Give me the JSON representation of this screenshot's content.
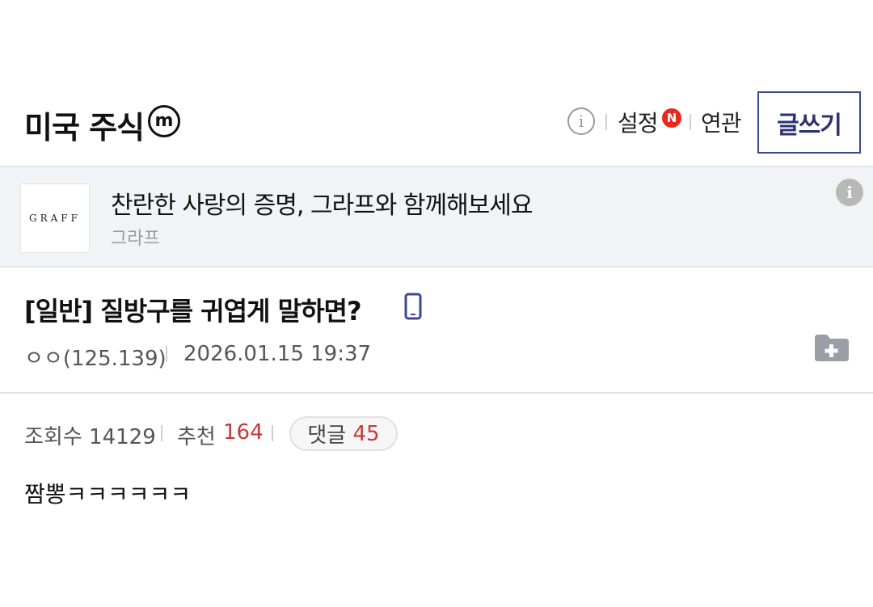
{
  "header": {
    "gallery_title": "미국 주식",
    "minor_badge": "m",
    "info_icon": "i",
    "settings_label": "설정",
    "new_badge": "N",
    "related_label": "연관",
    "write_label": "글쓰기"
  },
  "ad": {
    "logo_text": "GRAFF",
    "headline": "찬란한 사랑의 증명, 그라프와 함께해보세요",
    "advertiser": "그라프",
    "info_icon": "i"
  },
  "post": {
    "title": "[일반] 질방구를 귀엽게 말하면?",
    "author": "ㅇㅇ(125.139)",
    "date": "2026.01.15 19:37",
    "views_label": "조회수 14129",
    "recommend_label": "추천",
    "recommend_count": "164",
    "comment_label": "댓글",
    "comment_count": "45",
    "body": "짬뽕ㅋㅋㅋㅋㅋㅋ"
  },
  "colors": {
    "accent_border": "#3b4890",
    "new_badge": "#e8271d",
    "count_red": "#c8383a",
    "ad_background": "#f2f3f6"
  },
  "icons": [
    "minor-gallery-icon",
    "info-icon",
    "new-badge-icon",
    "ad-info-icon",
    "mobile-icon",
    "folder-add-icon"
  ]
}
